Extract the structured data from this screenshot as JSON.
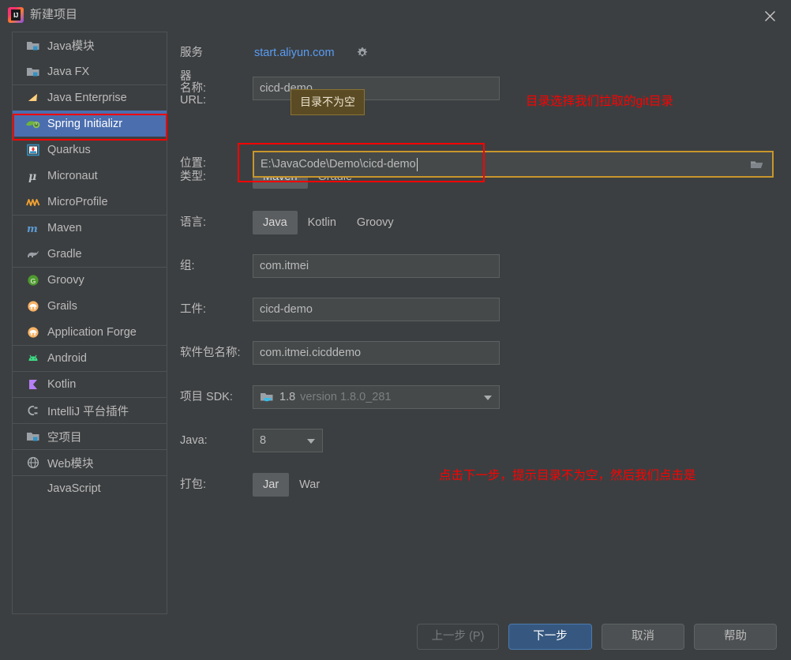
{
  "window": {
    "title": "新建项目",
    "app_icon": "intellij-idea-icon",
    "icon_text": "IJ",
    "close_icon": "close-icon"
  },
  "sidebar": {
    "items": [
      {
        "label": "Java模块",
        "icon": "java-module-icon",
        "separator": false,
        "selected": false
      },
      {
        "label": "Java FX",
        "icon": "javafx-icon",
        "separator": false,
        "selected": false
      },
      {
        "label": "Java Enterprise",
        "icon": "java-enterprise-icon",
        "separator": true,
        "selected": false
      },
      {
        "label": "Spring Initializr",
        "icon": "spring-icon",
        "separator": false,
        "selected": true
      },
      {
        "label": "Quarkus",
        "icon": "quarkus-icon",
        "separator": false,
        "selected": false
      },
      {
        "label": "Micronaut",
        "icon": "micronaut-icon",
        "separator": false,
        "selected": false
      },
      {
        "label": "MicroProfile",
        "icon": "microprofile-icon",
        "separator": false,
        "selected": false
      },
      {
        "label": "Maven",
        "icon": "maven-icon",
        "separator": true,
        "selected": false
      },
      {
        "label": "Gradle",
        "icon": "gradle-icon",
        "separator": false,
        "selected": false
      },
      {
        "label": "Groovy",
        "icon": "groovy-icon",
        "separator": true,
        "selected": false
      },
      {
        "label": "Grails",
        "icon": "grails-icon",
        "separator": false,
        "selected": false
      },
      {
        "label": "Application Forge",
        "icon": "application-forge-icon",
        "separator": false,
        "selected": false
      },
      {
        "label": "Android",
        "icon": "android-icon",
        "separator": true,
        "selected": false
      },
      {
        "label": "Kotlin",
        "icon": "kotlin-icon",
        "separator": true,
        "selected": false
      },
      {
        "label": "IntelliJ 平台插件",
        "icon": "intellij-plugin-icon",
        "separator": true,
        "selected": false
      },
      {
        "label": "空项目",
        "icon": "empty-project-icon",
        "separator": true,
        "selected": false
      },
      {
        "label": "Web模块",
        "icon": "web-module-icon",
        "separator": true,
        "selected": false
      },
      {
        "label": "JavaScript",
        "icon": "",
        "separator": true,
        "selected": false
      }
    ]
  },
  "form": {
    "server_url": {
      "label": "服务器 URL:",
      "value": "start.aliyun.com",
      "gear_icon": "gear-icon",
      "link_color": "#589df6"
    },
    "name": {
      "label": "名称:",
      "value": "cicd-demo"
    },
    "location": {
      "label": "位置:",
      "value": "E:\\JavaCode\\Demo\\cicd-demo",
      "browse_icon": "folder-open-icon",
      "focus_border_color": "#c8962b"
    },
    "type": {
      "label": "类型:",
      "options": [
        "Maven",
        "Gradle"
      ],
      "selected": "Maven"
    },
    "language": {
      "label": "语言:",
      "options": [
        "Java",
        "Kotlin",
        "Groovy"
      ],
      "selected": "Java"
    },
    "group": {
      "label": "组:",
      "value": "com.itmei"
    },
    "artifact": {
      "label": "工件:",
      "value": "cicd-demo"
    },
    "package_name": {
      "label": "软件包名称:",
      "value": "com.itmei.cicddemo"
    },
    "project_sdk": {
      "label": "项目 SDK:",
      "version": "1.8",
      "detail": "version 1.8.0_281",
      "icon": "jdk-folder-icon"
    },
    "java_version": {
      "label": "Java:",
      "value": "8"
    },
    "packaging": {
      "label": "打包:",
      "options": [
        "Jar",
        "War"
      ],
      "selected": "Jar"
    }
  },
  "tooltip": {
    "text": "目录不为空",
    "background": "#5b4b24"
  },
  "annotations": {
    "color": "#ff0000",
    "top": "目录选择我们拉取的git目录",
    "bottom": "点击下一步，提示目录不为空，然后我们点击是"
  },
  "buttons": {
    "back": {
      "label": "上一步 (P)",
      "disabled": true
    },
    "next": {
      "label": "下一步",
      "primary": true
    },
    "cancel": {
      "label": "取消",
      "disabled": false
    },
    "help": {
      "label": "帮助",
      "disabled": false
    }
  }
}
